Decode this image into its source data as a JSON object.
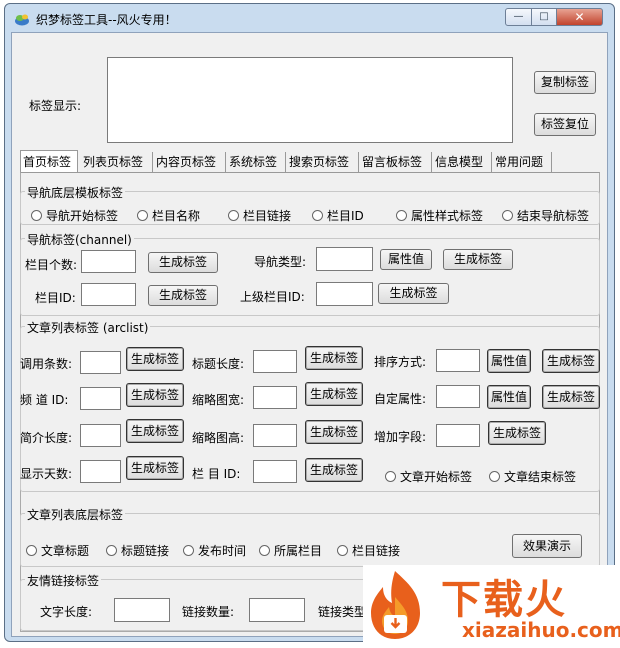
{
  "window": {
    "title": "织梦标签工具--风火专用！",
    "minimize_label": "—",
    "maximize_label": "□",
    "close_label": "✕"
  },
  "top": {
    "label_display": "标签显示:",
    "textarea_value": "",
    "copy_button": "复制标签",
    "reset_button": "标签复位"
  },
  "tabs": [
    {
      "label": "首页标签"
    },
    {
      "label": "列表页标签"
    },
    {
      "label": "内容页标签"
    },
    {
      "label": "系统标签"
    },
    {
      "label": "搜索页标签"
    },
    {
      "label": "留言板标签"
    },
    {
      "label": "信息模型"
    },
    {
      "label": "常用问题"
    }
  ],
  "nav_template": {
    "legend": "导航底层模板标签",
    "radios": [
      "导航开始标签",
      "栏目名称",
      "栏目链接",
      "栏目ID",
      "属性样式标签",
      "结束导航标签"
    ]
  },
  "channel": {
    "legend": "导航标签(channel)",
    "count_label": "栏目个数:",
    "id_label": "栏目ID:",
    "nav_type_label": "导航类型:",
    "parent_id_label": "上级栏目ID:",
    "gen_button": "生成标签",
    "attr_button": "属性值"
  },
  "arclist": {
    "legend": "文章列表标签 (arclist)",
    "gen_button": "生成标签",
    "attr_button": "属性值",
    "col1": [
      "调用条数:",
      "频 道 ID:",
      "简介长度:",
      "显示天数:"
    ],
    "col2": [
      "标题长度:",
      "缩略图宽:",
      "缩略图高:",
      "栏 目 ID:"
    ],
    "col3": [
      "排序方式:",
      "自定属性:",
      "增加字段:"
    ],
    "radio_start": "文章开始标签",
    "radio_end": "文章结束标签"
  },
  "arclist_bottom": {
    "legend": "文章列表底层标签",
    "radios": [
      "文章标题",
      "标题链接",
      "发布时间",
      "所属栏目",
      "栏目链接"
    ],
    "demo_button": "效果演示"
  },
  "friendlink": {
    "legend": "友情链接标签",
    "text_len_label": "文字长度:",
    "link_count_label": "链接数量:",
    "link_type_label": "链接类型:"
  },
  "watermark": {
    "cn": "下载火",
    "en": "xiazaihuo.com"
  },
  "colors": {
    "window_frame": "#c9dcef",
    "client_bg": "#f0f0f0",
    "close_button": "#c1432c",
    "watermark_orange": "#e8601c"
  }
}
